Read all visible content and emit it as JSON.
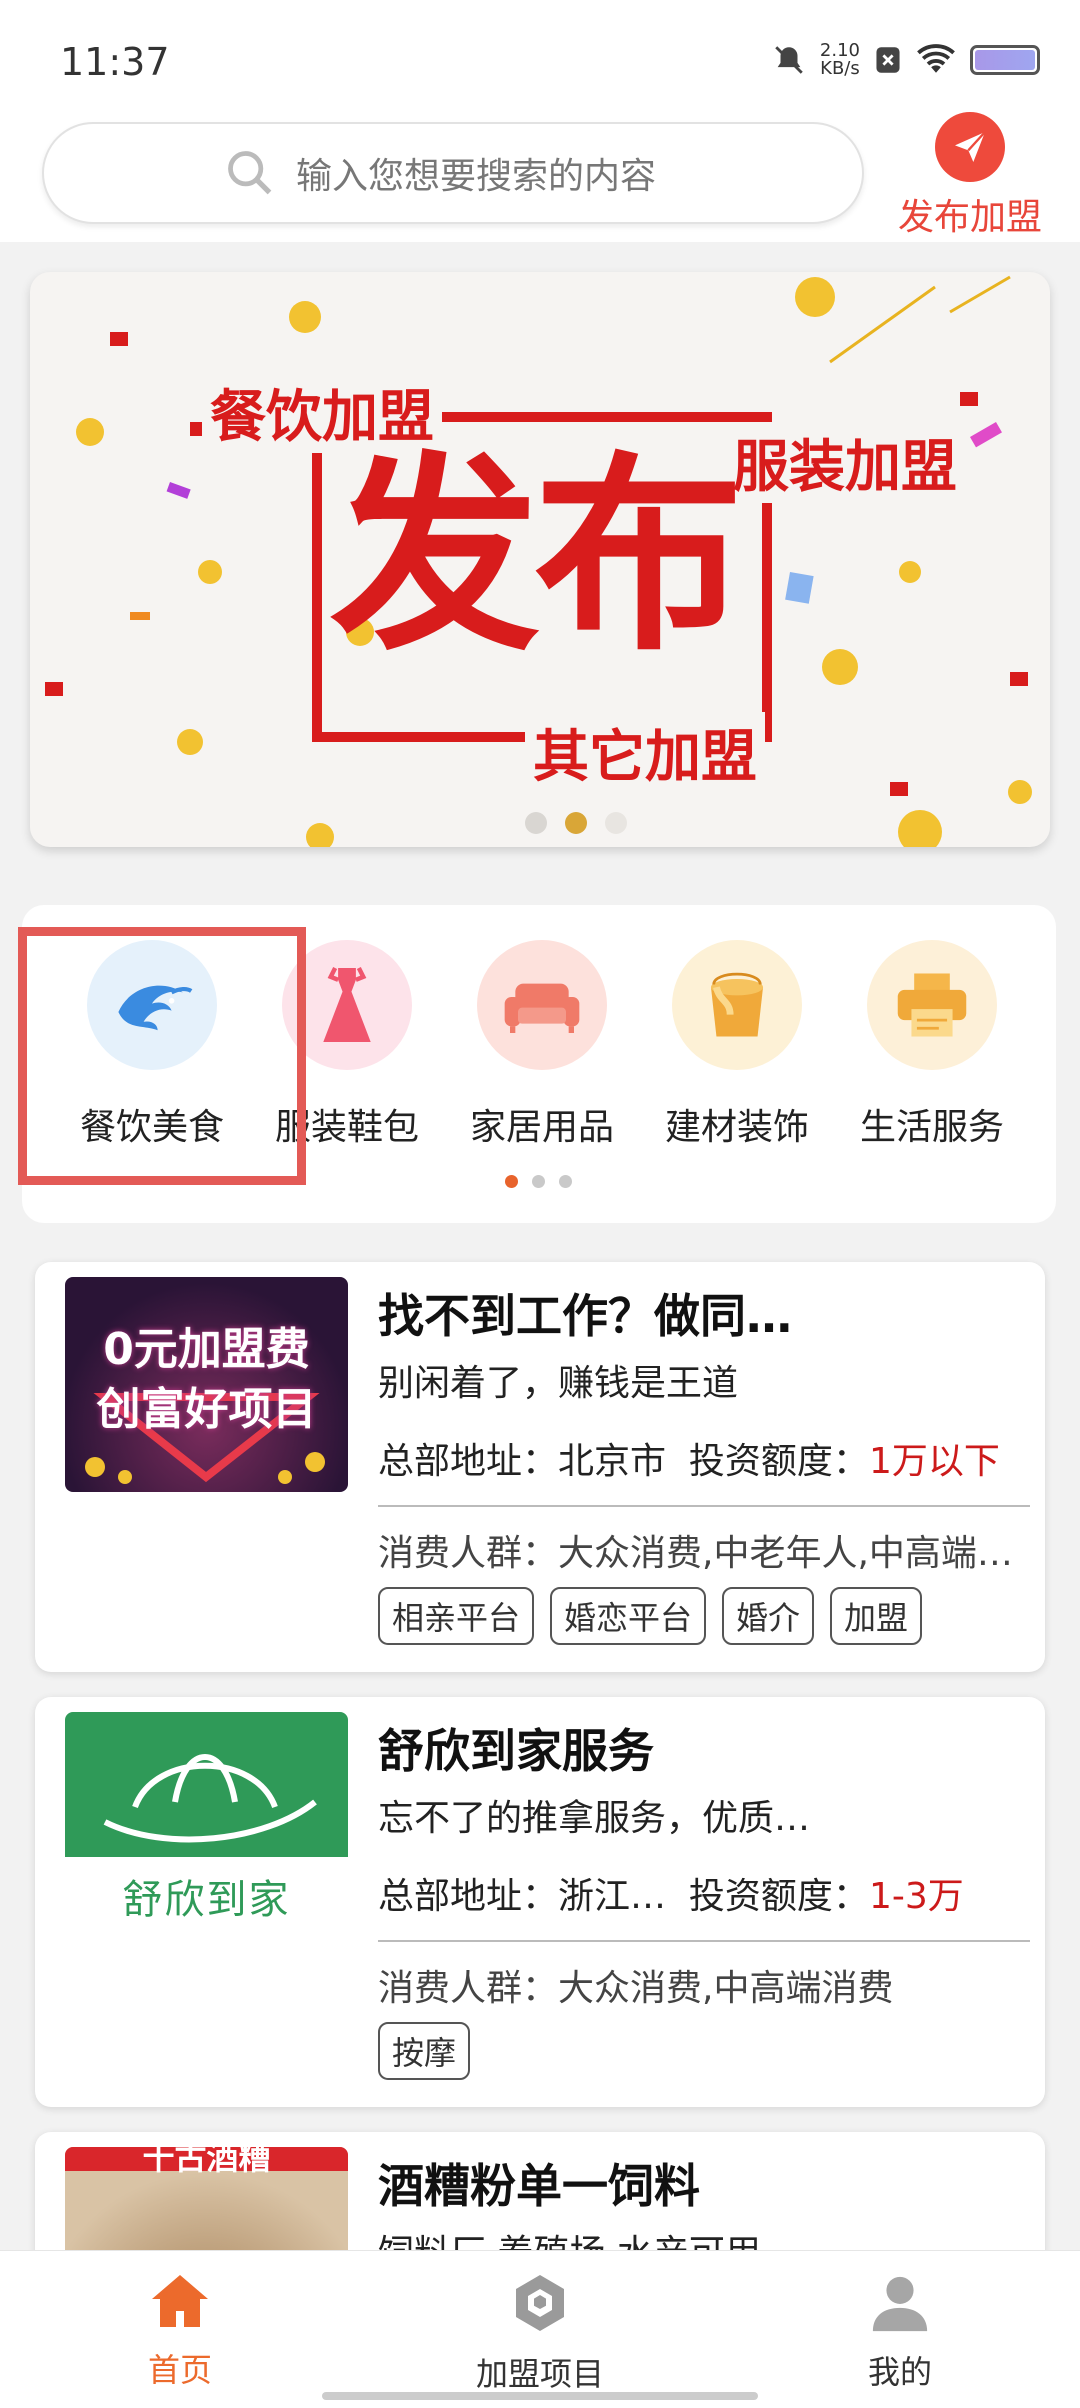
{
  "status": {
    "time": "11:37",
    "speed_value": "2.10",
    "speed_unit": "KB/s"
  },
  "search": {
    "placeholder": "输入您想要搜索的内容"
  },
  "publish": {
    "label": "发布加盟"
  },
  "banner": {
    "line1": "餐饮加盟",
    "line2": "服装加盟",
    "main": "发布",
    "line3": "其它加盟",
    "active_dot": 1
  },
  "categories": [
    {
      "label": "餐饮美食",
      "icon": "shrimp-icon"
    },
    {
      "label": "服装鞋包",
      "icon": "dress-icon"
    },
    {
      "label": "家居用品",
      "icon": "sofa-icon"
    },
    {
      "label": "建材装饰",
      "icon": "paint-bucket-icon"
    },
    {
      "label": "生活服务",
      "icon": "printer-icon"
    }
  ],
  "cards": [
    {
      "thumb_line1": "0元加盟费",
      "thumb_line2": "创富好项目",
      "title": "找不到工作？做同…",
      "desc": "别闲着了，赚钱是王道",
      "addr_label": "总部地址：",
      "addr": "北京市",
      "invest_label": "投资额度：",
      "invest": "1万以下",
      "group_label": "消费人群：",
      "group": "大众消费,中老年人,中高端…",
      "tags": [
        "相亲平台",
        "婚恋平台",
        "婚介",
        "加盟"
      ]
    },
    {
      "thumb_text": "舒欣到家",
      "title": "舒欣到家服务",
      "desc": "忘不了的推拿服务，优质…",
      "addr_label": "总部地址：",
      "addr": "浙江…",
      "invest_label": "投资额度：",
      "invest": "1-3万",
      "group_label": "消费人群：",
      "group": "大众消费,中高端消费",
      "tags": [
        "按摩"
      ]
    },
    {
      "thumb_text": "十古酒糟",
      "title": "酒糟粉单一饲料",
      "desc": "饲料厂,养殖场,水产可用"
    }
  ],
  "nav": [
    {
      "label": "首页",
      "icon": "home-icon",
      "active": true
    },
    {
      "label": "加盟项目",
      "icon": "hexagon-icon",
      "active": false
    },
    {
      "label": "我的",
      "icon": "user-icon",
      "active": false
    }
  ],
  "colors": {
    "accent": "#e8632c",
    "brand_red": "#e8463a",
    "price_red": "#cc1a1a"
  }
}
